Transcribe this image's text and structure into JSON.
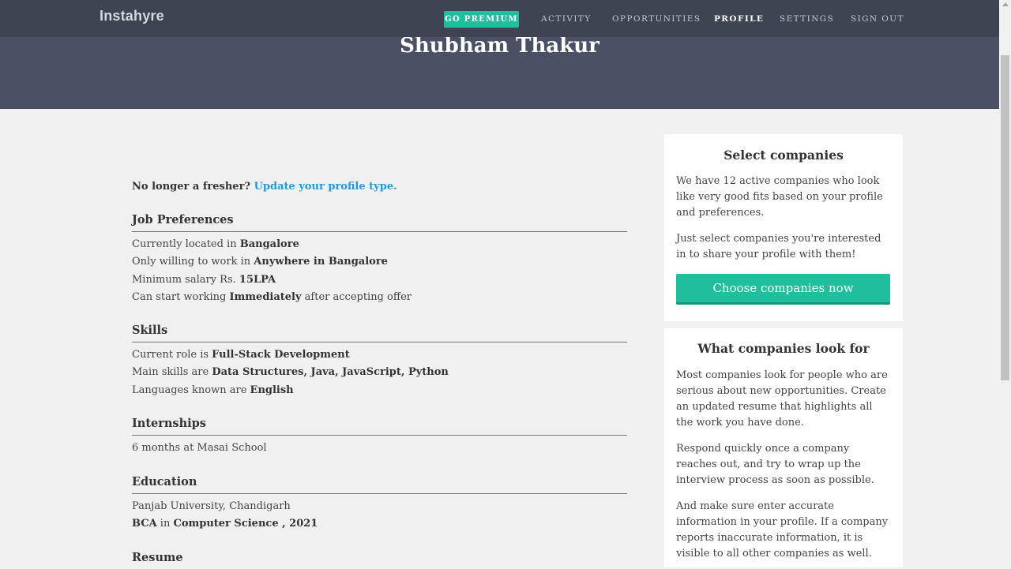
{
  "header": {
    "logo": "Instahyre",
    "premium_label": "GO PREMIUM",
    "nav": [
      "ACTIVITY",
      "OPPORTUNITIES",
      "PROFILE",
      "SETTINGS",
      "SIGN OUT"
    ]
  },
  "hero": {
    "name": "Shubham Thakur"
  },
  "fresher": {
    "prefix": "No longer a fresher?",
    "link": "Update your profile type."
  },
  "job_preferences": {
    "title": "Job Preferences",
    "lines": [
      {
        "pre": "Currently located in ",
        "bold": "Bangalore",
        "post": ""
      },
      {
        "pre": "Only willing to work in ",
        "bold": "Anywhere in Bangalore",
        "post": ""
      },
      {
        "pre": "Minimum salary Rs. ",
        "bold": "15LPA",
        "post": ""
      },
      {
        "pre": "Can start working ",
        "bold": "Immediately",
        "post": " after accepting offer"
      }
    ]
  },
  "skills": {
    "title": "Skills",
    "lines": [
      {
        "pre": "Current role is ",
        "bold": "Full-Stack Development",
        "post": ""
      },
      {
        "pre": "Main skills are ",
        "bold": "Data Structures, Java, JavaScript, Python",
        "post": ""
      },
      {
        "pre": "Languages known are ",
        "bold": "English",
        "post": ""
      }
    ]
  },
  "internships": {
    "title": "Internships",
    "text": "6 months at Masai School"
  },
  "education": {
    "title": "Education",
    "school": "Panjab University, Chandigarh",
    "degree": "BCA",
    "in_word": " in ",
    "field": "Computer Science , 2021"
  },
  "resume": {
    "title": "Resume"
  },
  "select_card": {
    "title": "Select companies",
    "p1": "We have 12 active companies who look like very good fits based on your profile and preferences.",
    "p2": "Just select companies you're interested in to share your profile with them!",
    "button": "Choose companies now"
  },
  "look_card": {
    "title": "What companies look for",
    "p1": "Most companies look for people who are serious about new opportunities. Create an updated resume that highlights all the work you have done.",
    "p2": "Respond quickly once a company reaches out, and try to wrap up the interview process as soon as possible.",
    "p3": "And make sure enter accurate information in your profile. If a company reports inaccurate information, it is visible to all other companies as well."
  }
}
